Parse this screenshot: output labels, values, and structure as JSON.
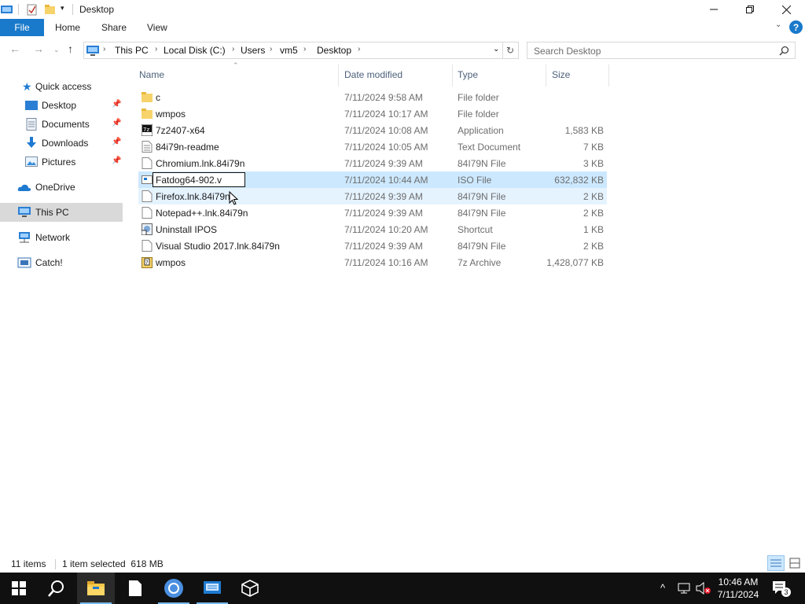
{
  "window": {
    "title": "Desktop"
  },
  "ribbon": {
    "file": "File",
    "tabs": [
      "Home",
      "Share",
      "View"
    ]
  },
  "address": {
    "crumbs": [
      "This PC",
      "Local Disk (C:)",
      "Users",
      "vm5",
      "Desktop"
    ]
  },
  "search": {
    "placeholder": "Search Desktop"
  },
  "nav": {
    "quick_access": "Quick access",
    "items": [
      "Desktop",
      "Documents",
      "Downloads",
      "Pictures"
    ],
    "onedrive": "OneDrive",
    "thispc": "This PC",
    "network": "Network",
    "catch": "Catch!"
  },
  "columns": {
    "name": "Name",
    "date": "Date modified",
    "type": "Type",
    "size": "Size"
  },
  "files": [
    {
      "name": "c",
      "date": "7/11/2024 9:58 AM",
      "type": "File folder",
      "size": "",
      "icon": "folder-icon"
    },
    {
      "name": "wmpos",
      "date": "7/11/2024 10:17 AM",
      "type": "File folder",
      "size": "",
      "icon": "folder-icon"
    },
    {
      "name": "7z2407-x64",
      "date": "7/11/2024 10:08 AM",
      "type": "Application",
      "size": "1,583 KB",
      "icon": "app-7z-icon"
    },
    {
      "name": "84i79n-readme",
      "date": "7/11/2024 10:05 AM",
      "type": "Text Document",
      "size": "7 KB",
      "icon": "text-file-icon"
    },
    {
      "name": "Chromium.lnk.84i79n",
      "date": "7/11/2024 9:39 AM",
      "type": "84I79N File",
      "size": "3 KB",
      "icon": "file-icon"
    },
    {
      "name": "Fatdog64-902.v",
      "date": "7/11/2024 10:44 AM",
      "type": "ISO File",
      "size": "632,832 KB",
      "icon": "iso-file-icon"
    },
    {
      "name": "Firefox.lnk.84i79n",
      "date": "7/11/2024 9:39 AM",
      "type": "84I79N File",
      "size": "2 KB",
      "icon": "file-icon"
    },
    {
      "name": "Notepad++.lnk.84i79n",
      "date": "7/11/2024 9:39 AM",
      "type": "84I79N File",
      "size": "2 KB",
      "icon": "file-icon"
    },
    {
      "name": "Uninstall IPOS",
      "date": "7/11/2024 10:20 AM",
      "type": "Shortcut",
      "size": "1 KB",
      "icon": "shortcut-icon"
    },
    {
      "name": "Visual Studio 2017.lnk.84i79n",
      "date": "7/11/2024 9:39 AM",
      "type": "84I79N File",
      "size": "2 KB",
      "icon": "file-icon"
    },
    {
      "name": "wmpos",
      "date": "7/11/2024 10:16 AM",
      "type": "7z Archive",
      "size": "1,428,077 KB",
      "icon": "archive-icon"
    }
  ],
  "status": {
    "count": "11 items",
    "selected": "1 item selected  618 MB"
  },
  "clock": {
    "time": "10:46 AM",
    "date": "7/11/2024"
  },
  "notifications": "3",
  "colors": {
    "accent": "#1979ca",
    "selection": "#cce8ff",
    "taskbar": "#101010"
  }
}
